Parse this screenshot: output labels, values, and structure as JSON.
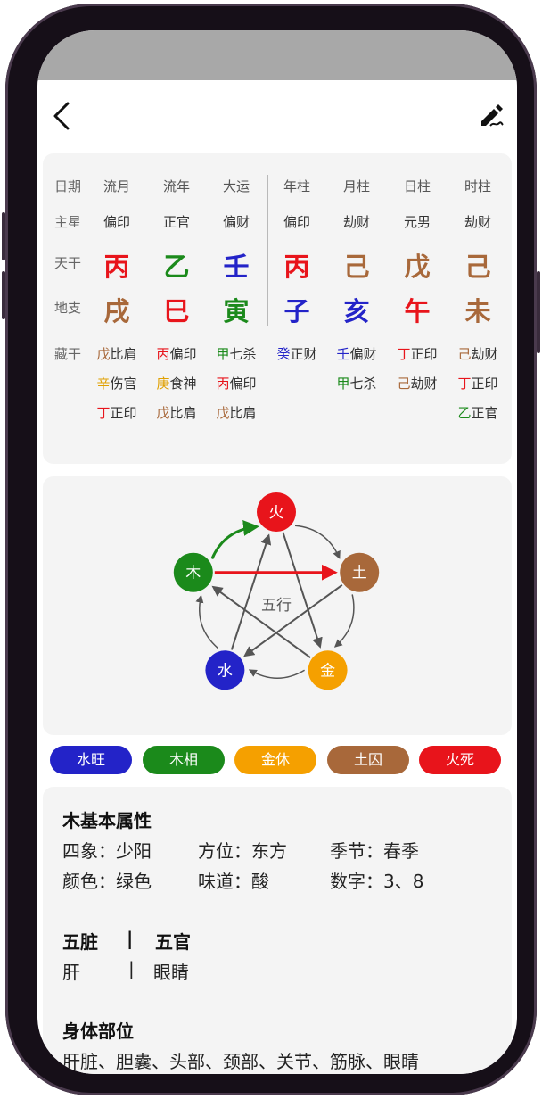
{
  "nav": {
    "back_icon": "chevron-left-icon",
    "edit_icon": "pen-edit-icon"
  },
  "chart": {
    "headers": [
      "日期",
      "流月",
      "流年",
      "大运",
      "年柱",
      "月柱",
      "日柱",
      "时柱"
    ],
    "zhuxing": {
      "label": "主星",
      "values": [
        "偏印",
        "正官",
        "偏财",
        "偏印",
        "劫财",
        "元男",
        "劫财"
      ]
    },
    "tiangan": {
      "label": "天干",
      "values": [
        {
          "char": "丙",
          "color": "#e8141b"
        },
        {
          "char": "乙",
          "color": "#1b8a1b"
        },
        {
          "char": "壬",
          "color": "#2323c8"
        },
        {
          "char": "丙",
          "color": "#e8141b"
        },
        {
          "char": "己",
          "color": "#a8683a"
        },
        {
          "char": "戊",
          "color": "#a8683a"
        },
        {
          "char": "己",
          "color": "#a8683a"
        }
      ]
    },
    "dizhi": {
      "label": "地支",
      "values": [
        {
          "char": "戌",
          "color": "#a8683a"
        },
        {
          "char": "巳",
          "color": "#e8141b"
        },
        {
          "char": "寅",
          "color": "#1b8a1b"
        },
        {
          "char": "子",
          "color": "#2323c8"
        },
        {
          "char": "亥",
          "color": "#2323c8"
        },
        {
          "char": "午",
          "color": "#e8141b"
        },
        {
          "char": "未",
          "color": "#a8683a"
        }
      ]
    },
    "canggan": {
      "label": "藏干",
      "columns": [
        [
          {
            "g": "戊",
            "c": "#a8683a",
            "s": "比肩"
          },
          {
            "g": "辛",
            "c": "#e0a000",
            "s": "伤官"
          },
          {
            "g": "丁",
            "c": "#e8141b",
            "s": "正印"
          }
        ],
        [
          {
            "g": "丙",
            "c": "#e8141b",
            "s": "偏印"
          },
          {
            "g": "庚",
            "c": "#e0a000",
            "s": "食神"
          },
          {
            "g": "戊",
            "c": "#a8683a",
            "s": "比肩"
          }
        ],
        [
          {
            "g": "甲",
            "c": "#1b8a1b",
            "s": "七杀"
          },
          {
            "g": "丙",
            "c": "#e8141b",
            "s": "偏印"
          },
          {
            "g": "戊",
            "c": "#a8683a",
            "s": "比肩"
          }
        ],
        [
          {
            "g": "癸",
            "c": "#2323c8",
            "s": "正财"
          }
        ],
        [
          {
            "g": "壬",
            "c": "#2323c8",
            "s": "偏财"
          },
          {
            "g": "甲",
            "c": "#1b8a1b",
            "s": "七杀"
          }
        ],
        [
          {
            "g": "丁",
            "c": "#e8141b",
            "s": "正印"
          },
          {
            "g": "己",
            "c": "#a8683a",
            "s": "劫财"
          }
        ],
        [
          {
            "g": "己",
            "c": "#a8683a",
            "s": "劫财"
          },
          {
            "g": "丁",
            "c": "#e8141b",
            "s": "正印"
          },
          {
            "g": "乙",
            "c": "#1b8a1b",
            "s": "正官"
          }
        ]
      ]
    }
  },
  "wuxing": {
    "center_label": "五行",
    "nodes": [
      {
        "name": "火",
        "color": "#e8141b"
      },
      {
        "name": "土",
        "color": "#a8683a"
      },
      {
        "name": "金",
        "color": "#f5a000"
      },
      {
        "name": "水",
        "color": "#2323c8"
      },
      {
        "name": "木",
        "color": "#1b8a1b"
      }
    ]
  },
  "tags": [
    {
      "label": "水旺",
      "color": "#2323c8"
    },
    {
      "label": "木相",
      "color": "#1b8a1b"
    },
    {
      "label": "金休",
      "color": "#f5a000"
    },
    {
      "label": "土囚",
      "color": "#a8683a"
    },
    {
      "label": "火死",
      "color": "#e8141b"
    }
  ],
  "info": {
    "title": "木基本属性",
    "sixiang": "四象：少阳",
    "fangwei": "方位：东方",
    "jijie": "季节：春季",
    "yanse": "颜色：绿色",
    "weidao": "味道：酸",
    "shuzi": "数字：3、8",
    "zang_title": "五脏",
    "sep1": "|",
    "guan_title": "五官",
    "zang_value": "肝",
    "sep2": "|",
    "guan_value": "眼睛",
    "body_title": "身体部位",
    "body_value": "肝脏、胆囊、头部、颈部、关节、筋脉、眼睛"
  }
}
